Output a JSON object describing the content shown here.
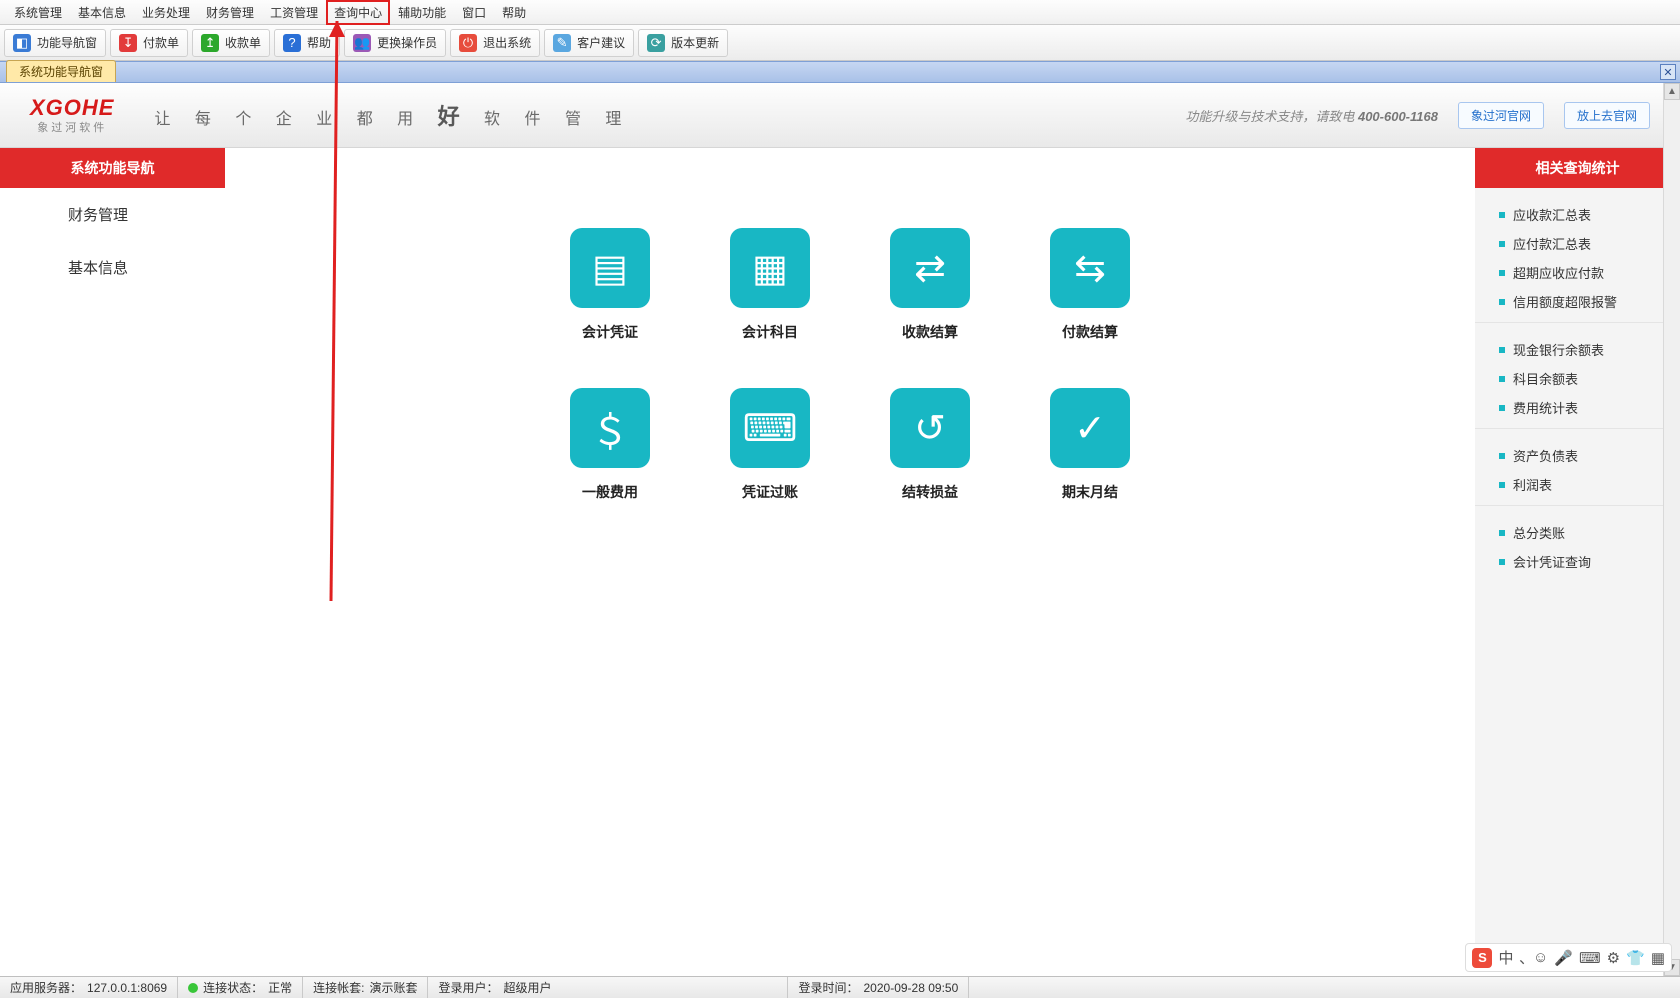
{
  "menu": {
    "items": [
      "系统管理",
      "基本信息",
      "业务处理",
      "财务管理",
      "工资管理",
      "查询中心",
      "辅助功能",
      "窗口",
      "帮助"
    ],
    "highlighted_index": 5
  },
  "toolbar": [
    {
      "icon_bg": "#3a7bd5",
      "icon": "◧",
      "label": "功能导航窗"
    },
    {
      "icon_bg": "#e23b3b",
      "icon": "↧",
      "label": "付款单"
    },
    {
      "icon_bg": "#2ca82c",
      "icon": "↥",
      "label": "收款单"
    },
    {
      "icon_bg": "#2a6fd6",
      "icon": "?",
      "label": "帮助"
    },
    {
      "icon_bg": "#9b59b6",
      "icon": "👥",
      "label": "更换操作员"
    },
    {
      "icon_bg": "#e74c3c",
      "icon": "⏻",
      "label": "退出系统"
    },
    {
      "icon_bg": "#5aa7e0",
      "icon": "✎",
      "label": "客户建议"
    },
    {
      "icon_bg": "#3aa0a0",
      "icon": "⟳",
      "label": "版本更新"
    }
  ],
  "window_tab": "系统功能导航窗",
  "banner": {
    "logo_name": "XGOHE",
    "logo_sub": "象过河软件",
    "tagline_parts": [
      "让 每 个 企 业 都 用 ",
      " 软 件 管 理"
    ],
    "tagline_big": "好",
    "support_text": "功能升级与技术支持，请致电 ",
    "support_phone": "400-600-1168",
    "link1": "象过河官网",
    "link2": "放上去官网"
  },
  "leftnav": {
    "header": "系统功能导航",
    "items": [
      "财务管理",
      "基本信息"
    ]
  },
  "tiles": [
    {
      "icon": "▤",
      "label": "会计凭证"
    },
    {
      "icon": "▦",
      "label": "会计科目"
    },
    {
      "icon": "⇄",
      "label": "收款结算"
    },
    {
      "icon": "⇆",
      "label": "付款结算"
    },
    {
      "icon": "＄",
      "label": "一般费用"
    },
    {
      "icon": "⌨",
      "label": "凭证过账"
    },
    {
      "icon": "↺",
      "label": "结转损益"
    },
    {
      "icon": "✓",
      "label": "期末月结"
    }
  ],
  "rightpanel": {
    "header": "相关查询统计",
    "groups": [
      [
        "应收款汇总表",
        "应付款汇总表",
        "超期应收应付款",
        "信用额度超限报警"
      ],
      [
        "现金银行余额表",
        "科目余额表",
        "费用统计表"
      ],
      [
        "资产负债表",
        "利润表"
      ],
      [
        "总分类账",
        "会计凭证查询"
      ]
    ]
  },
  "status": {
    "server_label": "应用服务器：",
    "server": "127.0.0.1:8069",
    "conn_label": "连接状态：",
    "conn": "正常",
    "acct_label": "连接帐套:",
    "acct": "演示账套",
    "user_label": "登录用户：",
    "user": "超级用户",
    "time_label": "登录时间：",
    "time": "2020-09-28 09:50"
  },
  "ime": [
    "中",
    "､",
    "☺",
    "🎤",
    "⌨",
    "⚙",
    "👕",
    "▦"
  ]
}
